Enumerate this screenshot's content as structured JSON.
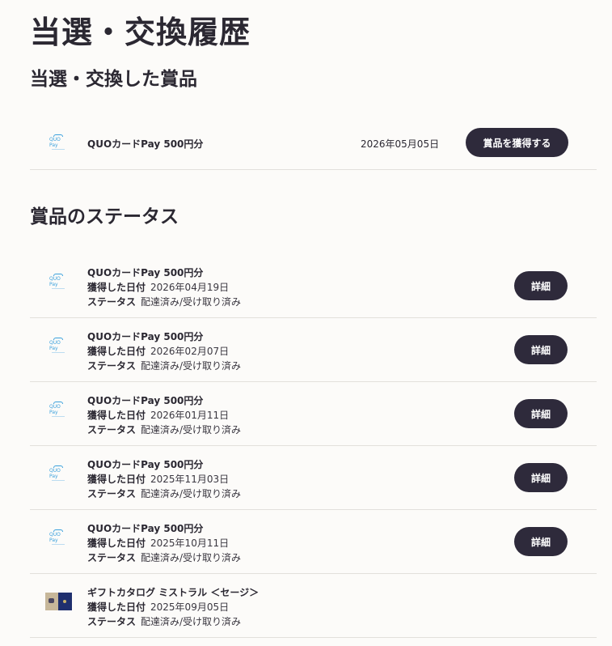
{
  "page": {
    "title": "当選・交換履歴"
  },
  "won_section": {
    "title": "当選・交換した賞品",
    "items": [
      {
        "thumb_label": "QUO Pay",
        "name": "QUOカードPay 500円分",
        "date": "2026年05月05日",
        "button_label": "賞品を獲得する"
      }
    ]
  },
  "status_section": {
    "title": "賞品のステータス",
    "date_label": "獲得した日付",
    "status_label": "ステータス",
    "items": [
      {
        "thumb_label": "QUO Pay",
        "name": "QUOカードPay 500円分",
        "date": "2026年04月19日",
        "status": "配達済み/受け取り済み",
        "button_label": "詳細"
      },
      {
        "thumb_label": "QUO Pay",
        "name": "QUOカードPay 500円分",
        "date": "2026年02月07日",
        "status": "配達済み/受け取り済み",
        "button_label": "詳細"
      },
      {
        "thumb_label": "QUO Pay",
        "name": "QUOカードPay 500円分",
        "date": "2026年01月11日",
        "status": "配達済み/受け取り済み",
        "button_label": "詳細"
      },
      {
        "thumb_label": "QUO Pay",
        "name": "QUOカードPay 500円分",
        "date": "2025年11月03日",
        "status": "配達済み/受け取り済み",
        "button_label": "詳細"
      },
      {
        "thumb_label": "QUO Pay",
        "name": "QUOカードPay 500円分",
        "date": "2025年10月11日",
        "status": "配達済み/受け取り済み",
        "button_label": "詳細"
      },
      {
        "name": "ギフトカタログ ミストラル ＜セージ＞",
        "date": "2025年09月05日",
        "status": "配達済み/受け取り済み"
      }
    ]
  }
}
